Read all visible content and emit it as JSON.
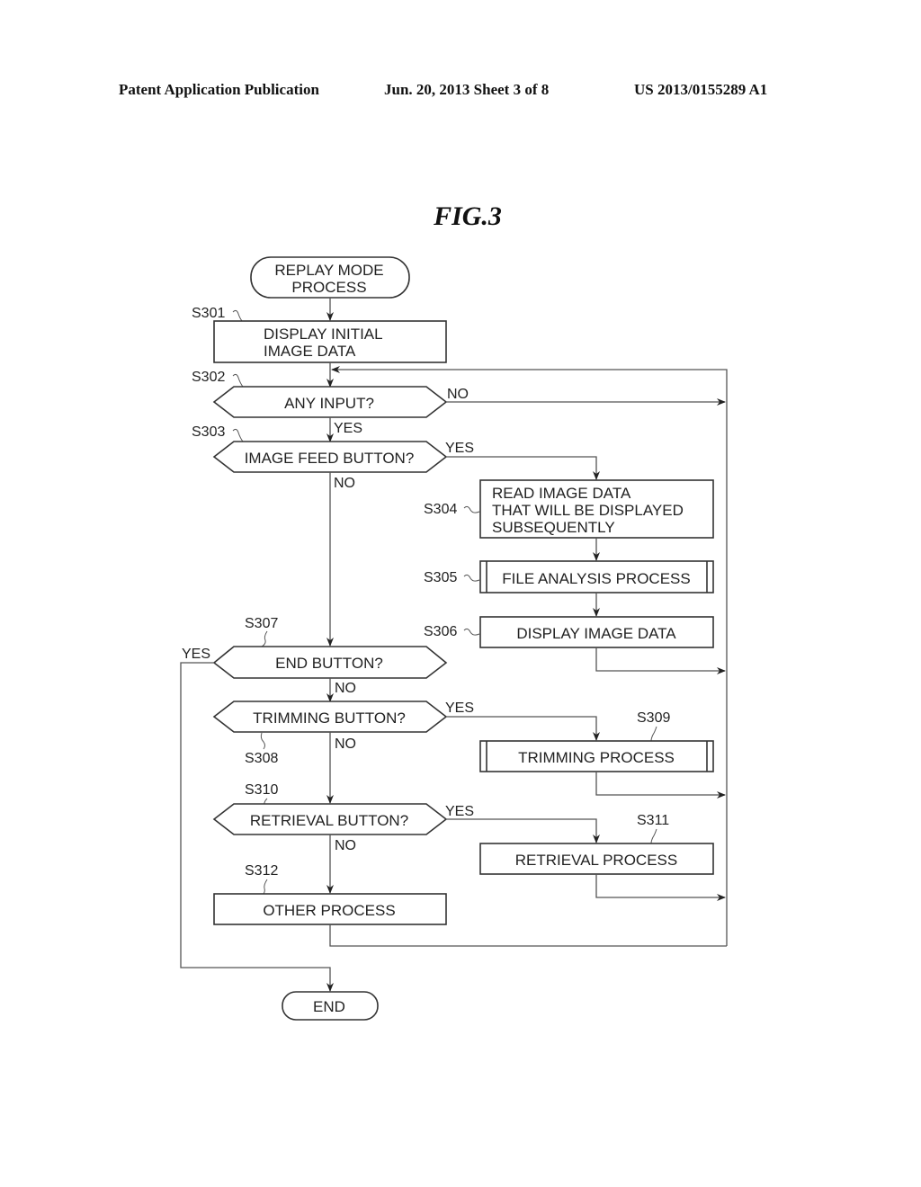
{
  "header": {
    "left": "Patent Application Publication",
    "date_sheet": "Jun. 20, 2013  Sheet 3 of 8",
    "pub_number": "US 2013/0155289 A1"
  },
  "figure": {
    "title": "FIG.3"
  },
  "flowchart": {
    "start": {
      "line1": "REPLAY MODE",
      "line2": "PROCESS"
    },
    "s301": {
      "id": "S301",
      "line1": "DISPLAY INITIAL",
      "line2": "IMAGE DATA"
    },
    "s302": {
      "id": "S302",
      "text": "ANY INPUT?",
      "no": "NO",
      "yes": "YES"
    },
    "s303": {
      "id": "S303",
      "text": "IMAGE FEED BUTTON?",
      "yes": "YES",
      "no": "NO"
    },
    "s304": {
      "id": "S304",
      "line1": "READ IMAGE DATA",
      "line2": "THAT WILL BE DISPLAYED",
      "line3": "SUBSEQUENTLY"
    },
    "s305": {
      "id": "S305",
      "text": "FILE ANALYSIS PROCESS"
    },
    "s306": {
      "id": "S306",
      "text": "DISPLAY IMAGE DATA"
    },
    "s307": {
      "id": "S307",
      "text": "END BUTTON?",
      "yes": "YES",
      "no": "NO"
    },
    "s308": {
      "id": "S308",
      "text": "TRIMMING BUTTON?",
      "yes": "YES",
      "no": "NO"
    },
    "s309": {
      "id": "S309",
      "text": "TRIMMING PROCESS"
    },
    "s310": {
      "id": "S310",
      "text": "RETRIEVAL BUTTON?",
      "yes": "YES",
      "no": "NO"
    },
    "s311": {
      "id": "S311",
      "text": "RETRIEVAL PROCESS"
    },
    "s312": {
      "id": "S312",
      "text": "OTHER PROCESS"
    },
    "end": {
      "text": "END"
    }
  }
}
